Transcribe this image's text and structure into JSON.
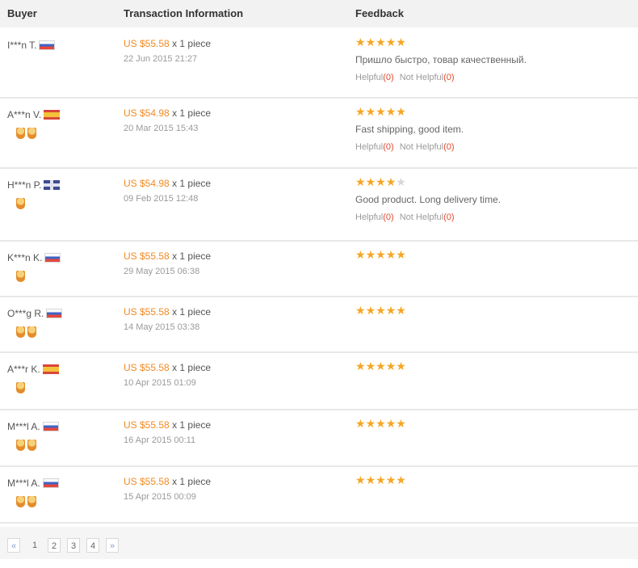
{
  "columns": {
    "buyer": "Buyer",
    "transaction": "Transaction Information",
    "feedback": "Feedback"
  },
  "colors": {
    "star_on": "#f5a623",
    "star_off": "#d6d6d6",
    "price": "#f08a24",
    "helpful_count": "#e04a2f"
  },
  "reviews": [
    {
      "buyer": "I***n T.",
      "flag": "ru",
      "badges": 0,
      "price": "US $55.58",
      "qty": "x 1 piece",
      "date": "22 Jun 2015 21:27",
      "stars": 5,
      "comment": "Пришло быстро, товар качественный.",
      "helpful_label": "Helpful",
      "helpful_count": "(0)",
      "not_helpful_label": "Not Helpful",
      "not_helpful_count": "(0)"
    },
    {
      "buyer": "A***n V.",
      "flag": "es",
      "badges": 2,
      "price": "US $54.98",
      "qty": "x 1 piece",
      "date": "20 Mar 2015 15:43",
      "stars": 5,
      "comment": "Fast shipping, good item.",
      "helpful_label": "Helpful",
      "helpful_count": "(0)",
      "not_helpful_label": "Not Helpful",
      "not_helpful_count": "(0)"
    },
    {
      "buyer": "H***n P.",
      "flag": "gb",
      "badges": 1,
      "price": "US $54.98",
      "qty": "x 1 piece",
      "date": "09 Feb 2015 12:48",
      "stars": 4,
      "comment": "Good product. Long delivery time.",
      "helpful_label": "Helpful",
      "helpful_count": "(0)",
      "not_helpful_label": "Not Helpful",
      "not_helpful_count": "(0)"
    },
    {
      "buyer": "K***n K.",
      "flag": "ru",
      "badges": 1,
      "price": "US $55.58",
      "qty": "x 1 piece",
      "date": "29 May 2015 06:38",
      "stars": 5,
      "comment": "",
      "helpful_label": "",
      "helpful_count": "",
      "not_helpful_label": "",
      "not_helpful_count": ""
    },
    {
      "buyer": "O***g R.",
      "flag": "ru",
      "badges": 2,
      "price": "US $55.58",
      "qty": "x 1 piece",
      "date": "14 May 2015 03:38",
      "stars": 5,
      "comment": "",
      "helpful_label": "",
      "helpful_count": "",
      "not_helpful_label": "",
      "not_helpful_count": ""
    },
    {
      "buyer": "A***r K.",
      "flag": "es",
      "badges": 1,
      "price": "US $55.58",
      "qty": "x 1 piece",
      "date": "10 Apr 2015 01:09",
      "stars": 5,
      "comment": "",
      "helpful_label": "",
      "helpful_count": "",
      "not_helpful_label": "",
      "not_helpful_count": ""
    },
    {
      "buyer": "M***l A.",
      "flag": "ru",
      "badges": 2,
      "price": "US $55.58",
      "qty": "x 1 piece",
      "date": "16 Apr 2015 00:11",
      "stars": 5,
      "comment": "",
      "helpful_label": "",
      "helpful_count": "",
      "not_helpful_label": "",
      "not_helpful_count": ""
    },
    {
      "buyer": "M***l A.",
      "flag": "ru",
      "badges": 2,
      "price": "US $55.58",
      "qty": "x 1 piece",
      "date": "15 Apr 2015 00:09",
      "stars": 5,
      "comment": "",
      "helpful_label": "",
      "helpful_count": "",
      "not_helpful_label": "",
      "not_helpful_count": ""
    }
  ],
  "pagination": {
    "prev": "«",
    "pages": [
      "1",
      "2",
      "3",
      "4"
    ],
    "current": "1",
    "next": "»"
  }
}
